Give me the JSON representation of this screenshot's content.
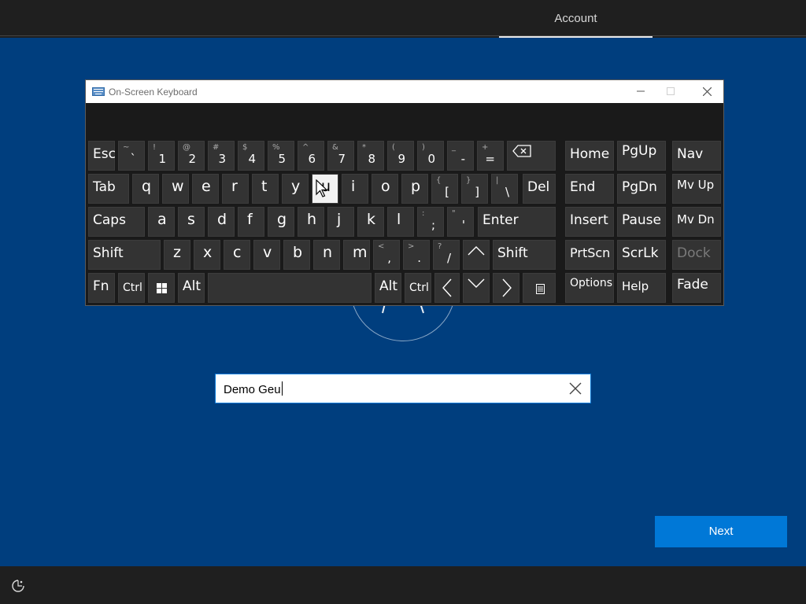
{
  "header": {
    "tab_label": "Account"
  },
  "osk": {
    "title": "On-Screen Keyboard",
    "keys": {
      "esc": "Esc",
      "tab": "Tab",
      "caps": "Caps",
      "shift": "Shift",
      "fn": "Fn",
      "ctrl": "Ctrl",
      "alt": "Alt",
      "del": "Del",
      "enter": "Enter",
      "home": "Home",
      "pgup": "PgUp",
      "nav": "Nav",
      "end": "End",
      "pgdn": "PgDn",
      "mvup": "Mv Up",
      "insert": "Insert",
      "pause": "Pause",
      "mvdn": "Mv Dn",
      "prtscn": "PrtScn",
      "scrlk": "ScrLk",
      "dock": "Dock",
      "options": "Options",
      "help": "Help",
      "fade": "Fade"
    },
    "row1": [
      {
        "alt": "~",
        "main": "`"
      },
      {
        "alt": "!",
        "main": "1"
      },
      {
        "alt": "@",
        "main": "2"
      },
      {
        "alt": "#",
        "main": "3"
      },
      {
        "alt": "$",
        "main": "4"
      },
      {
        "alt": "%",
        "main": "5"
      },
      {
        "alt": "^",
        "main": "6"
      },
      {
        "alt": "&",
        "main": "7"
      },
      {
        "alt": "*",
        "main": "8"
      },
      {
        "alt": "(",
        "main": "9"
      },
      {
        "alt": ")",
        "main": "0"
      },
      {
        "alt": "_",
        "main": "-"
      },
      {
        "alt": "+",
        "main": "="
      }
    ],
    "row2": [
      "q",
      "w",
      "e",
      "r",
      "t",
      "y",
      "u",
      "i",
      "o",
      "p"
    ],
    "row2_sym": [
      {
        "alt": "{",
        "main": "["
      },
      {
        "alt": "}",
        "main": "]"
      },
      {
        "alt": "|",
        "main": "\\"
      }
    ],
    "row3": [
      "a",
      "s",
      "d",
      "f",
      "g",
      "h",
      "j",
      "k",
      "l"
    ],
    "row3_sym": [
      {
        "alt": ":",
        "main": ";"
      },
      {
        "alt": "\"",
        "main": "'"
      }
    ],
    "row4": [
      "z",
      "x",
      "c",
      "v",
      "b",
      "n",
      "m"
    ],
    "row4_sym": [
      {
        "alt": "<",
        "main": ","
      },
      {
        "alt": ">",
        "main": "."
      },
      {
        "alt": "?",
        "main": "/"
      }
    ]
  },
  "name_input": {
    "value": "Demo Geu"
  },
  "next_button": {
    "label": "Next"
  }
}
